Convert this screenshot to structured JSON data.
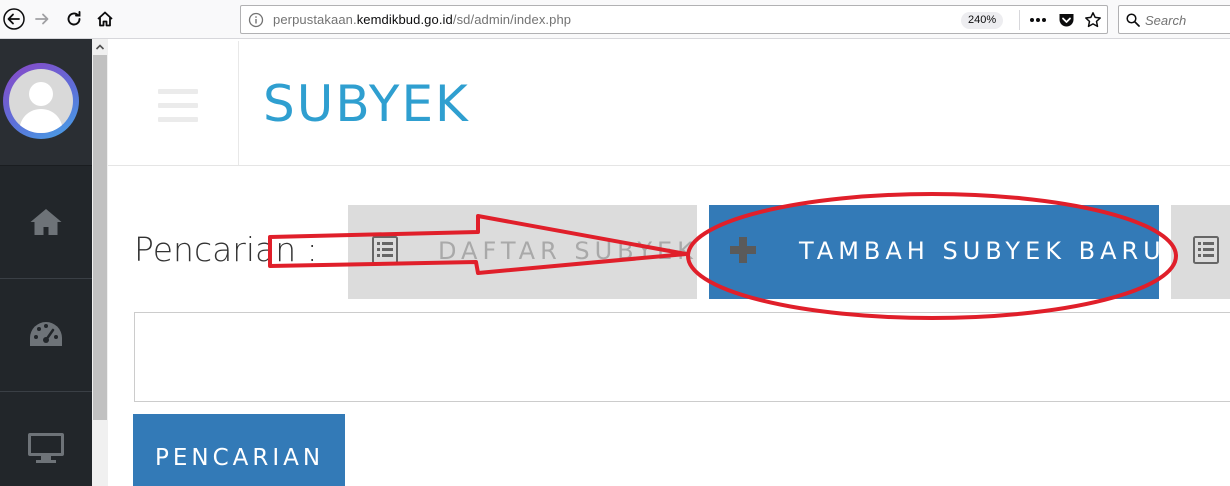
{
  "browser": {
    "url_prefix": "perpustakaan.",
    "url_domain": "kemdikbud.go.id",
    "url_path": "/sd/admin/index.php",
    "zoom": "240%",
    "search_placeholder": "Search"
  },
  "header": {
    "title": "SUBYEK"
  },
  "main": {
    "search_label": "Pencarian :",
    "list_button": "DAFTAR SUBYEK",
    "add_button": "TAMBAH SUBYEK BARU",
    "search_input_value": "",
    "search_button": "PENCARIAN"
  },
  "annotation": {
    "color": "#e01f2a"
  },
  "theme": {
    "primary": "#337ab7",
    "title_color": "#2f9fd0",
    "sidebar_bg": "#22262a"
  }
}
